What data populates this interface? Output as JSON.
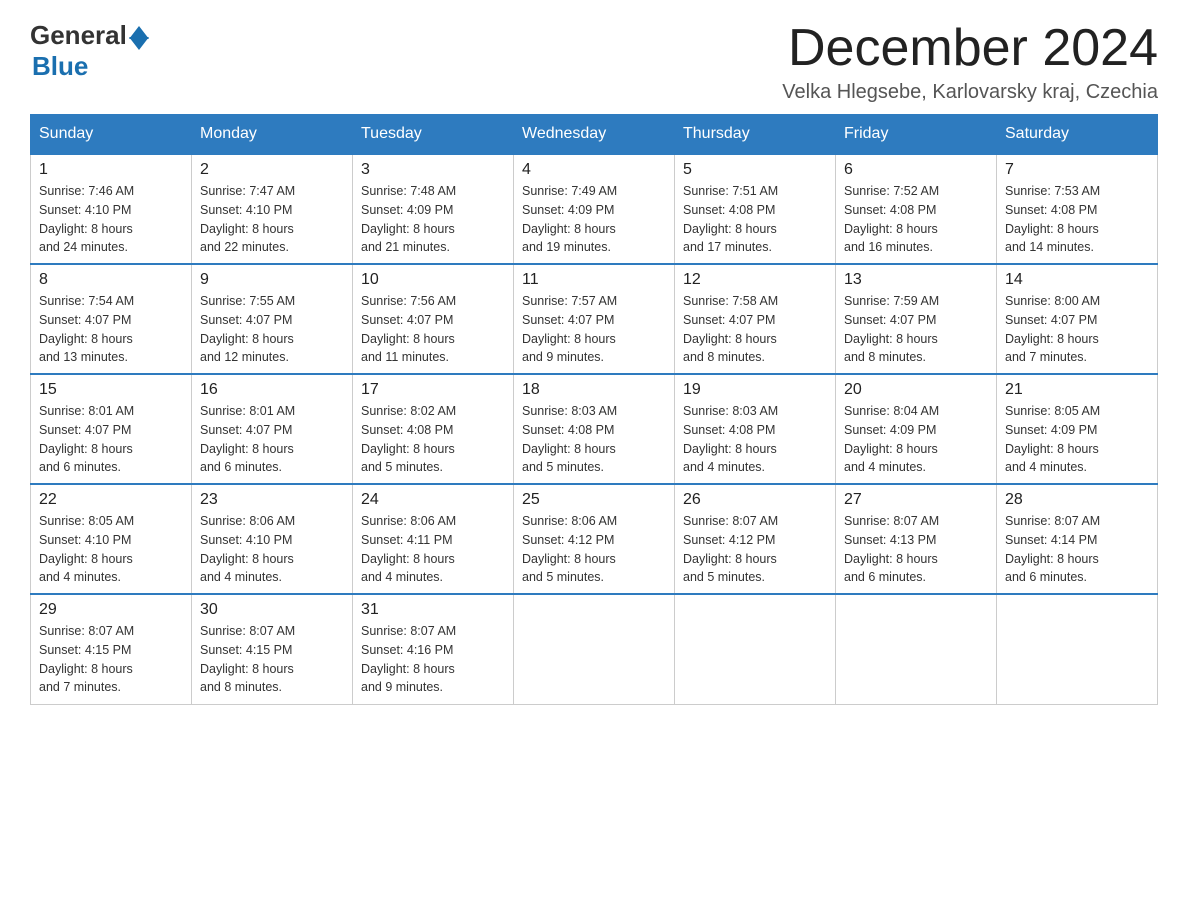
{
  "header": {
    "logo_general": "General",
    "logo_blue": "Blue",
    "month_title": "December 2024",
    "subtitle": "Velka Hlegsebe, Karlovarsky kraj, Czechia"
  },
  "weekdays": [
    "Sunday",
    "Monday",
    "Tuesday",
    "Wednesday",
    "Thursday",
    "Friday",
    "Saturday"
  ],
  "weeks": [
    [
      {
        "day": "1",
        "sunrise": "7:46 AM",
        "sunset": "4:10 PM",
        "daylight": "8 hours and 24 minutes."
      },
      {
        "day": "2",
        "sunrise": "7:47 AM",
        "sunset": "4:10 PM",
        "daylight": "8 hours and 22 minutes."
      },
      {
        "day": "3",
        "sunrise": "7:48 AM",
        "sunset": "4:09 PM",
        "daylight": "8 hours and 21 minutes."
      },
      {
        "day": "4",
        "sunrise": "7:49 AM",
        "sunset": "4:09 PM",
        "daylight": "8 hours and 19 minutes."
      },
      {
        "day": "5",
        "sunrise": "7:51 AM",
        "sunset": "4:08 PM",
        "daylight": "8 hours and 17 minutes."
      },
      {
        "day": "6",
        "sunrise": "7:52 AM",
        "sunset": "4:08 PM",
        "daylight": "8 hours and 16 minutes."
      },
      {
        "day": "7",
        "sunrise": "7:53 AM",
        "sunset": "4:08 PM",
        "daylight": "8 hours and 14 minutes."
      }
    ],
    [
      {
        "day": "8",
        "sunrise": "7:54 AM",
        "sunset": "4:07 PM",
        "daylight": "8 hours and 13 minutes."
      },
      {
        "day": "9",
        "sunrise": "7:55 AM",
        "sunset": "4:07 PM",
        "daylight": "8 hours and 12 minutes."
      },
      {
        "day": "10",
        "sunrise": "7:56 AM",
        "sunset": "4:07 PM",
        "daylight": "8 hours and 11 minutes."
      },
      {
        "day": "11",
        "sunrise": "7:57 AM",
        "sunset": "4:07 PM",
        "daylight": "8 hours and 9 minutes."
      },
      {
        "day": "12",
        "sunrise": "7:58 AM",
        "sunset": "4:07 PM",
        "daylight": "8 hours and 8 minutes."
      },
      {
        "day": "13",
        "sunrise": "7:59 AM",
        "sunset": "4:07 PM",
        "daylight": "8 hours and 8 minutes."
      },
      {
        "day": "14",
        "sunrise": "8:00 AM",
        "sunset": "4:07 PM",
        "daylight": "8 hours and 7 minutes."
      }
    ],
    [
      {
        "day": "15",
        "sunrise": "8:01 AM",
        "sunset": "4:07 PM",
        "daylight": "8 hours and 6 minutes."
      },
      {
        "day": "16",
        "sunrise": "8:01 AM",
        "sunset": "4:07 PM",
        "daylight": "8 hours and 6 minutes."
      },
      {
        "day": "17",
        "sunrise": "8:02 AM",
        "sunset": "4:08 PM",
        "daylight": "8 hours and 5 minutes."
      },
      {
        "day": "18",
        "sunrise": "8:03 AM",
        "sunset": "4:08 PM",
        "daylight": "8 hours and 5 minutes."
      },
      {
        "day": "19",
        "sunrise": "8:03 AM",
        "sunset": "4:08 PM",
        "daylight": "8 hours and 4 minutes."
      },
      {
        "day": "20",
        "sunrise": "8:04 AM",
        "sunset": "4:09 PM",
        "daylight": "8 hours and 4 minutes."
      },
      {
        "day": "21",
        "sunrise": "8:05 AM",
        "sunset": "4:09 PM",
        "daylight": "8 hours and 4 minutes."
      }
    ],
    [
      {
        "day": "22",
        "sunrise": "8:05 AM",
        "sunset": "4:10 PM",
        "daylight": "8 hours and 4 minutes."
      },
      {
        "day": "23",
        "sunrise": "8:06 AM",
        "sunset": "4:10 PM",
        "daylight": "8 hours and 4 minutes."
      },
      {
        "day": "24",
        "sunrise": "8:06 AM",
        "sunset": "4:11 PM",
        "daylight": "8 hours and 4 minutes."
      },
      {
        "day": "25",
        "sunrise": "8:06 AM",
        "sunset": "4:12 PM",
        "daylight": "8 hours and 5 minutes."
      },
      {
        "day": "26",
        "sunrise": "8:07 AM",
        "sunset": "4:12 PM",
        "daylight": "8 hours and 5 minutes."
      },
      {
        "day": "27",
        "sunrise": "8:07 AM",
        "sunset": "4:13 PM",
        "daylight": "8 hours and 6 minutes."
      },
      {
        "day": "28",
        "sunrise": "8:07 AM",
        "sunset": "4:14 PM",
        "daylight": "8 hours and 6 minutes."
      }
    ],
    [
      {
        "day": "29",
        "sunrise": "8:07 AM",
        "sunset": "4:15 PM",
        "daylight": "8 hours and 7 minutes."
      },
      {
        "day": "30",
        "sunrise": "8:07 AM",
        "sunset": "4:15 PM",
        "daylight": "8 hours and 8 minutes."
      },
      {
        "day": "31",
        "sunrise": "8:07 AM",
        "sunset": "4:16 PM",
        "daylight": "8 hours and 9 minutes."
      },
      null,
      null,
      null,
      null
    ]
  ],
  "labels": {
    "sunrise": "Sunrise:",
    "sunset": "Sunset:",
    "daylight": "Daylight:"
  }
}
